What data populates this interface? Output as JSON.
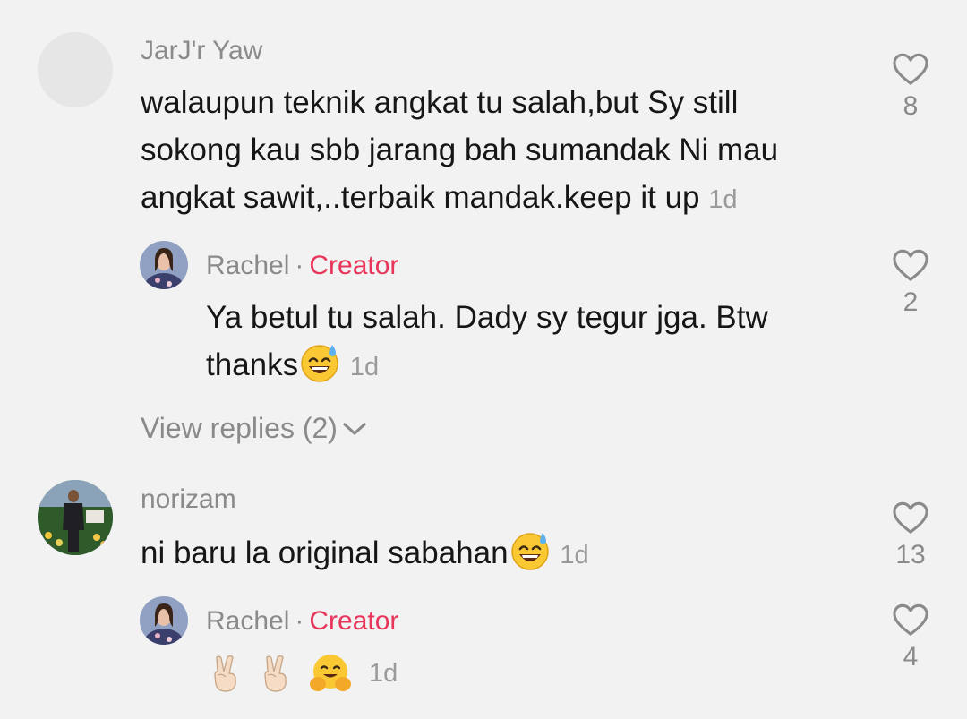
{
  "comments": [
    {
      "username": "JarJ'r Yaw",
      "lines": [
        "walaupun teknik angkat tu salah,but Sy still",
        "sokong kau sbb jarang bah sumandak Ni mau",
        "angkat sawit,..terbaik mandak.keep it up"
      ],
      "time": "1d",
      "likes": "8"
    },
    {
      "username": "Rachel",
      "badge": "Creator",
      "separator": "·",
      "lines": [
        "Ya betul tu salah. Dady sy tegur jga. Btw",
        "thanks"
      ],
      "emoji": "sweat-smile-emoji",
      "time": "1d",
      "likes": "2"
    },
    {
      "view_replies": "View replies (2)"
    },
    {
      "username": "norizam",
      "lines": [
        "ni baru la original sabahan"
      ],
      "emoji": "sweat-smile-emoji",
      "time": "1d",
      "likes": "13"
    },
    {
      "username": "Rachel",
      "badge": "Creator",
      "separator": "·",
      "emojis": [
        "victory-hand-emoji",
        "victory-hand-emoji",
        "hugging-face-emoji"
      ],
      "time": "1d",
      "likes": "4"
    }
  ],
  "colors": {
    "background": "#f2f2f2",
    "text": "#161616",
    "muted": "#8a8a8a",
    "creator": "#e8355a"
  }
}
